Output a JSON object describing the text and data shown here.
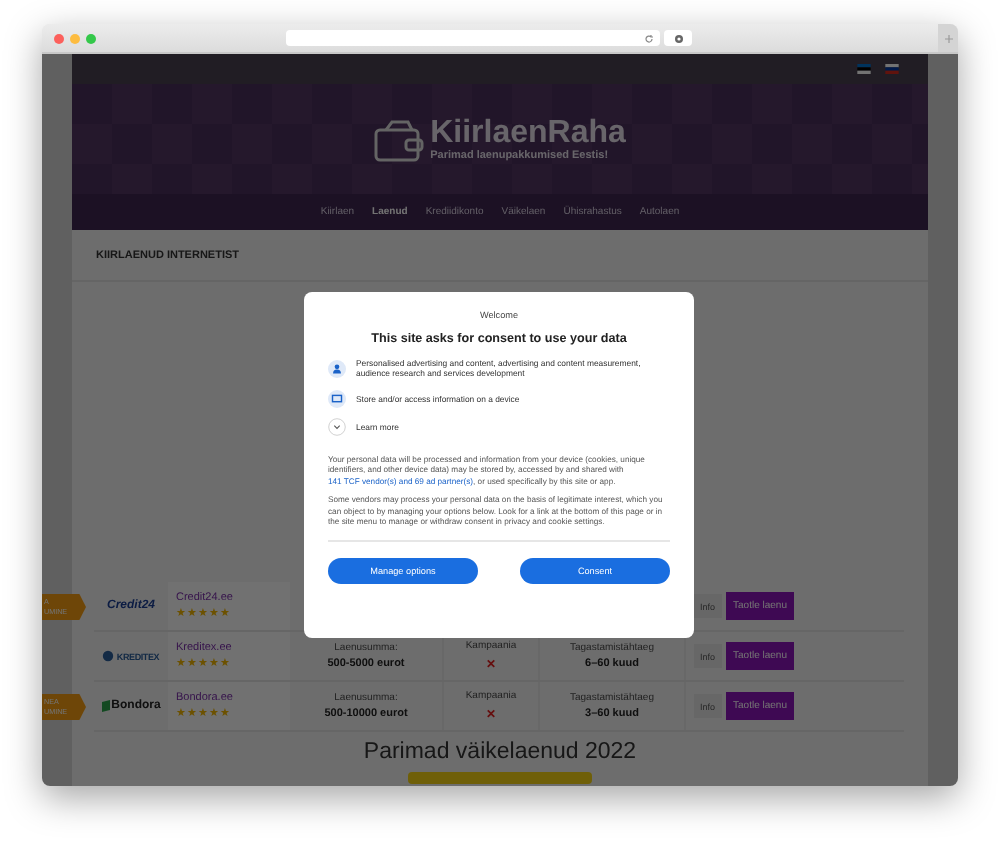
{
  "site": {
    "logo_title": "KiirlaenRaha",
    "logo_tagline": "Parimad laenupakkumised Eestis!"
  },
  "nav": [
    {
      "label": "Kiirlaen",
      "selected": false
    },
    {
      "label": "Laenud",
      "selected": true
    },
    {
      "label": "Krediidikonto",
      "selected": false
    },
    {
      "label": "Väikelaen",
      "selected": false
    },
    {
      "label": "Ühisrahastus",
      "selected": false
    },
    {
      "label": "Autolaen",
      "selected": false
    }
  ],
  "section_title": "KIIRLAENUD INTERNETIST",
  "offers": [
    {
      "ribbon": [
        "A",
        "UMINE"
      ],
      "logo": {
        "kind": "credit24",
        "text": "Credit24"
      },
      "name": "Credit24.ee",
      "stars": 5,
      "info": "Info",
      "apply": "Taotle laenu"
    },
    {
      "logo": {
        "kind": "kreditex",
        "text": "KREDITEX"
      },
      "name": "Kreditex.ee",
      "stars": 5,
      "amount_label": "Laenusumma:",
      "amount": "500-5000 eurot",
      "campaign_label": "Kampaania",
      "campaign": "✕",
      "term_label": "Tagastamistähtaeg",
      "term": "6–60 kuud",
      "info": "Info",
      "apply": "Taotle laenu"
    },
    {
      "ribbon": [
        "NEA",
        "UMINE"
      ],
      "logo": {
        "kind": "bondora",
        "text": "Bondora"
      },
      "name": "Bondora.ee",
      "stars": 5,
      "amount_label": "Laenusumma:",
      "amount": "500-10000 eurot",
      "campaign_label": "Kampaania",
      "campaign": "✕",
      "term_label": "Tagastamistähtaeg",
      "term": "3–60 kuud",
      "info": "Info",
      "apply": "Taotle laenu"
    }
  ],
  "heading": "Parimad väikelaenud 2022",
  "consent": {
    "welcome": "Welcome",
    "title": "This site asks for consent to use your data",
    "purposes": [
      {
        "kind": "person",
        "text": "Personalised advertising and content, advertising and content measurement, audience research and services development"
      },
      {
        "kind": "device",
        "text": "Store and/or access information on a device"
      }
    ],
    "learn_more": "Learn more",
    "paragraph_1": {
      "before": "Your personal data will be processed and information from your device (cookies, unique identifiers, and other device data) may be stored by, accessed by and shared with ",
      "link": "141 TCF vendor(s) and 69 ad partner(s)",
      "after": ", or used specifically by this site or app."
    },
    "paragraph_2": "Some vendors may process your personal data on the basis of legitimate interest, which you can object to by managing your options below. Look for a link at the bottom of this page or in the site menu to manage or withdraw consent in privacy and cookie settings.",
    "buttons": [
      "Manage options",
      "Consent"
    ]
  }
}
